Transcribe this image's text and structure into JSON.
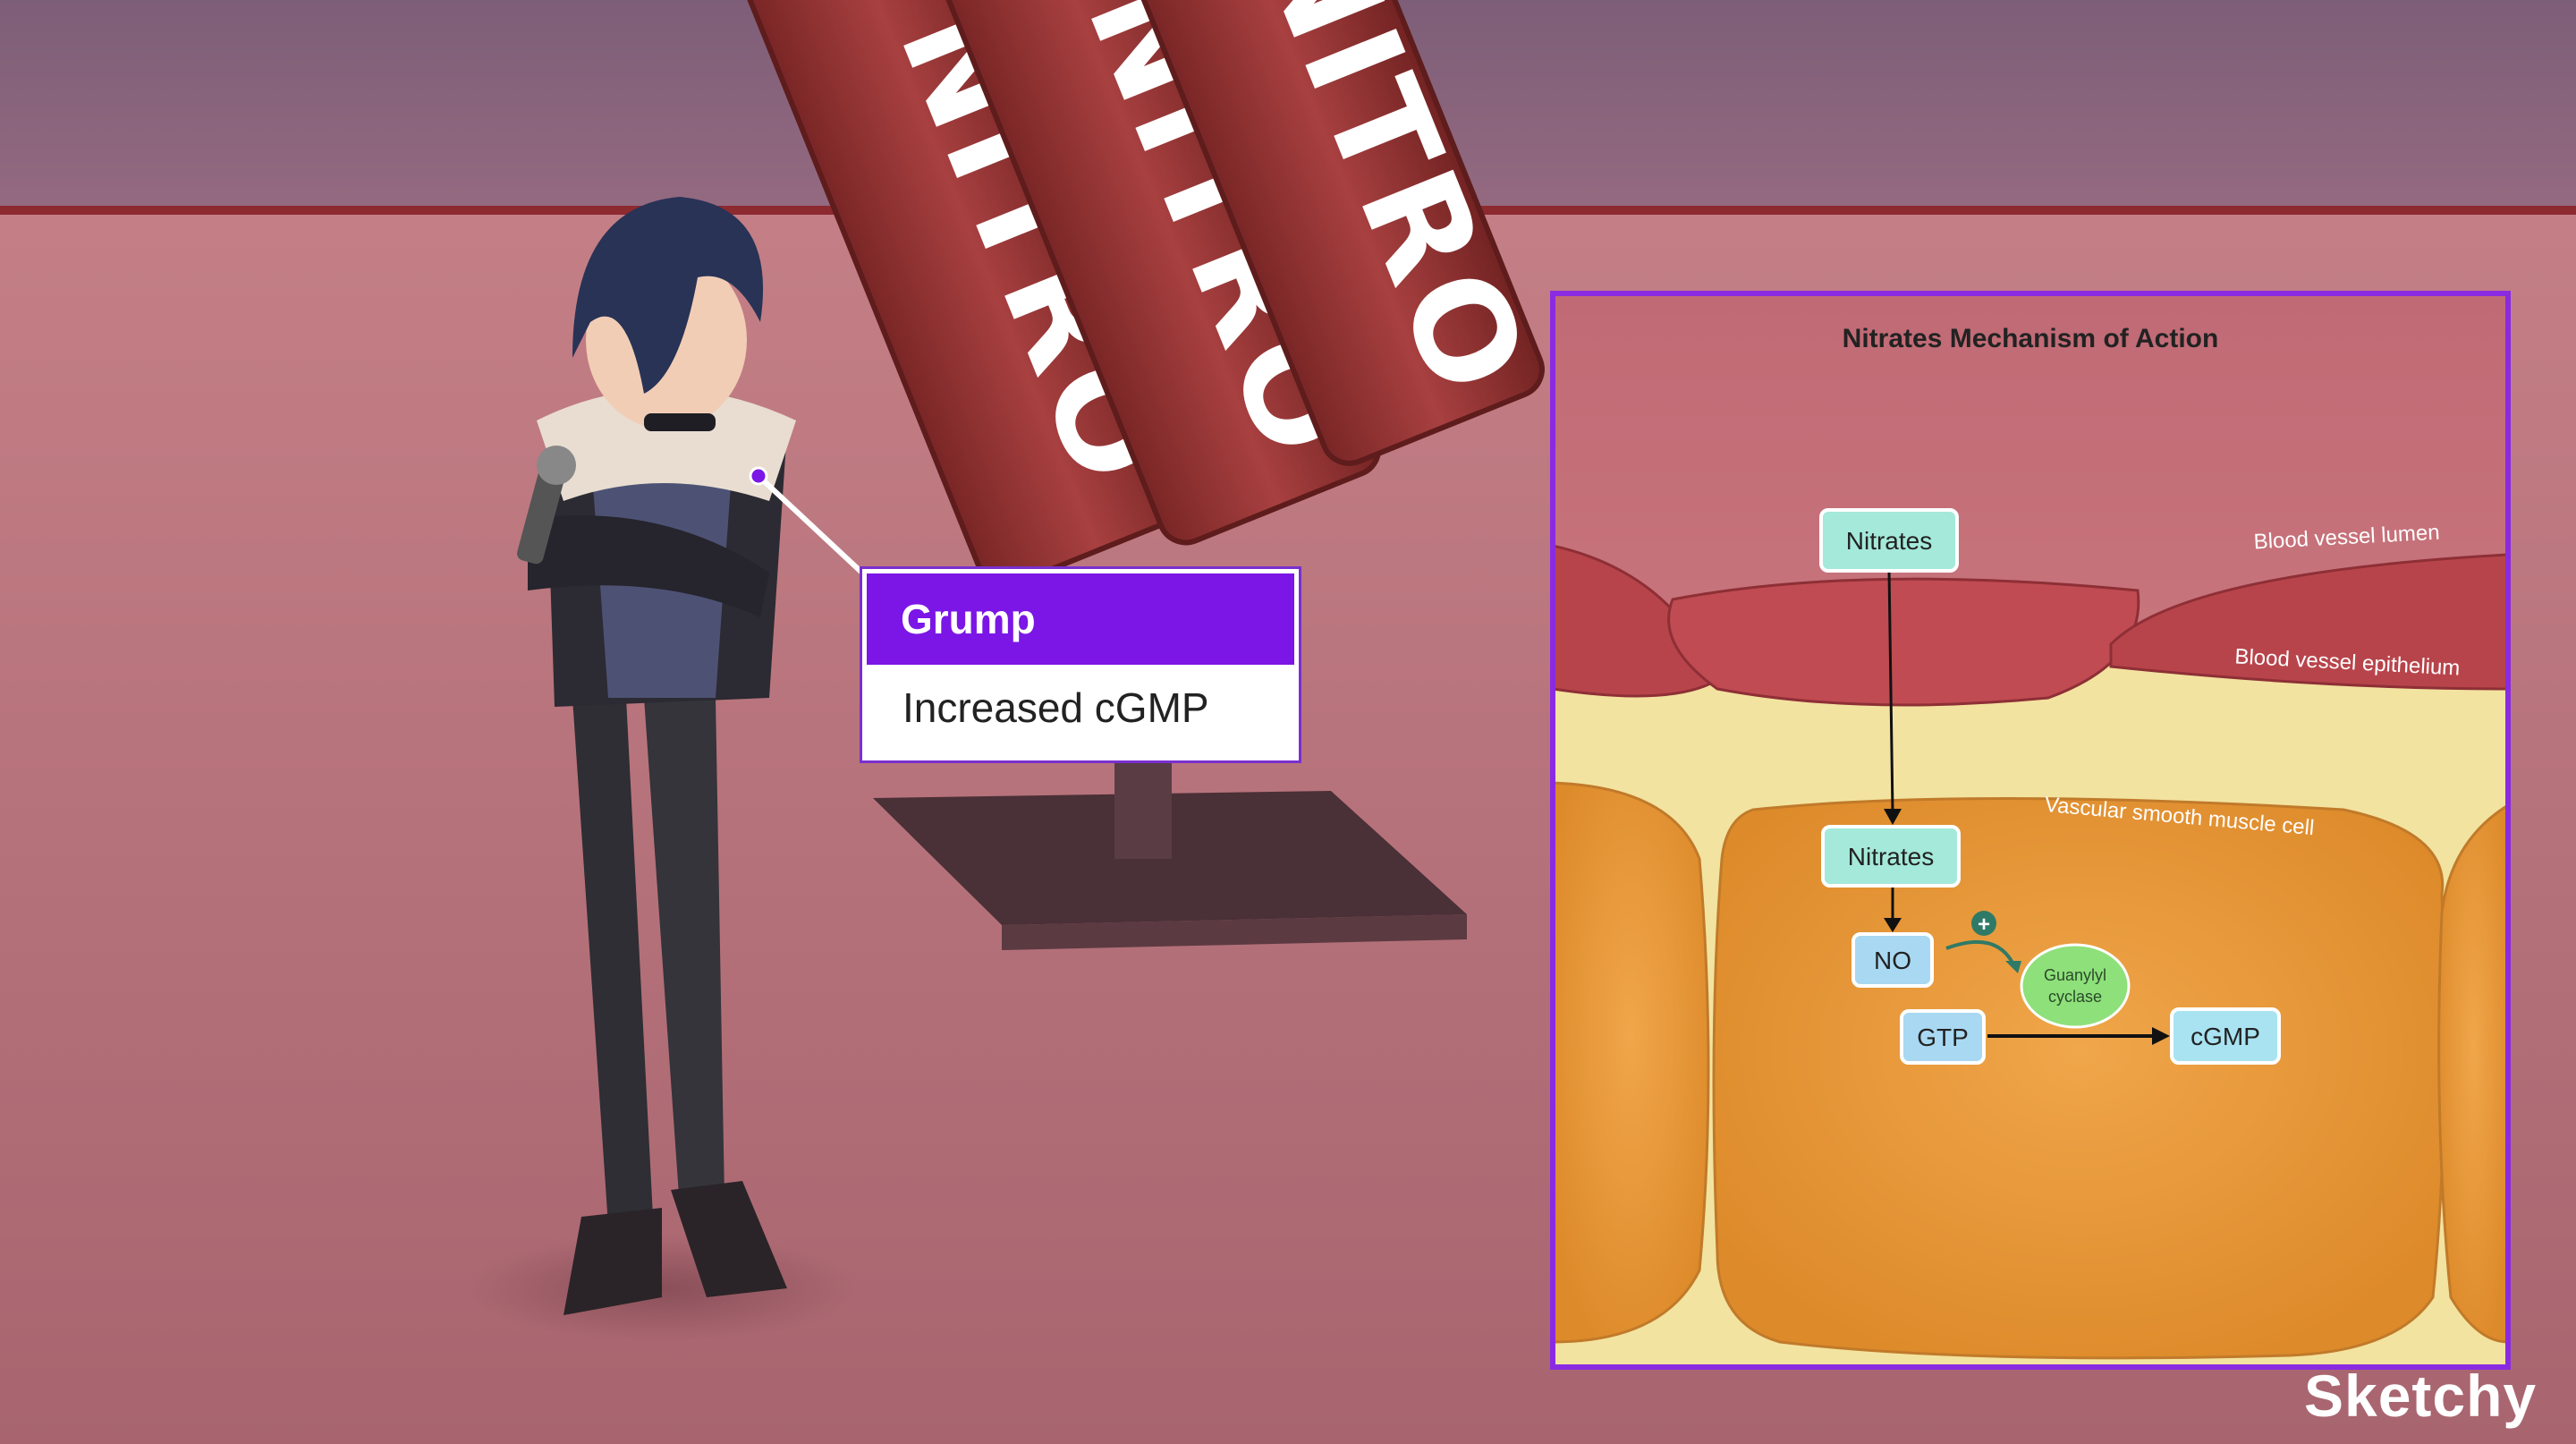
{
  "callout": {
    "title": "Grump",
    "subtitle": "Increased cGMP"
  },
  "sign_text": [
    "NITRO",
    "NITRO",
    "NITRO"
  ],
  "panel": {
    "title": "Nitrates Mechanism of Action",
    "labels": {
      "lumen": "Blood vessel lumen",
      "epithelium": "Blood vessel epithelium",
      "smooth_muscle": "Vascular smooth muscle cell"
    },
    "nodes": {
      "nitrates_outer": "Nitrates",
      "nitrates_inner": "Nitrates",
      "no": "NO",
      "guanylyl_line1": "Guanylyl",
      "guanylyl_line2": "cyclase",
      "gtp": "GTP",
      "cgmp": "cGMP",
      "plus": "+"
    }
  },
  "brand": "Sketchy",
  "colors": {
    "accent": "#7b16e6",
    "panel_border": "#8a2be2",
    "node_teal": "#9fe6d8",
    "node_blue": "#a9d8f2",
    "enzyme_green": "#8ee07a"
  }
}
